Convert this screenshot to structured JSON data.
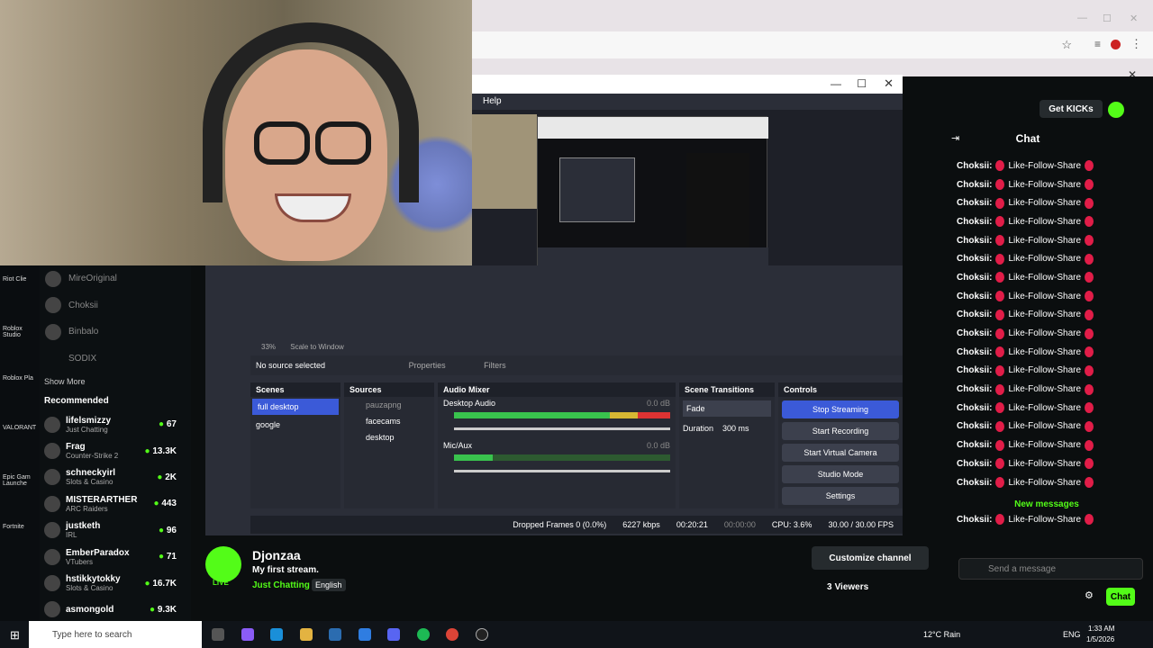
{
  "obs": {
    "menu_help": "Help",
    "zoom": "33%",
    "scale_mode": "Scale to Window",
    "no_source": "No source selected",
    "properties": "Properties",
    "filters": "Filters",
    "scenes_title": "Scenes",
    "scenes": [
      "full desktop",
      "google"
    ],
    "sources_title": "Sources",
    "sources": [
      "pauzapng",
      "facecams",
      "desktop"
    ],
    "mixer_title": "Audio Mixer",
    "desktop_audio": "Desktop Audio",
    "desktop_db": "0.0 dB",
    "mic_aux": "Mic/Aux",
    "mic_db": "0.0 dB",
    "transitions_title": "Scene Transitions",
    "transition": "Fade",
    "duration_label": "Duration",
    "duration": "300 ms",
    "controls_title": "Controls",
    "stop_streaming": "Stop Streaming",
    "start_recording": "Start Recording",
    "start_virtual_camera": "Start Virtual Camera",
    "studio_mode": "Studio Mode",
    "settings": "Settings",
    "dropped_frames": "Dropped Frames 0 (0.0%)",
    "bitrate": "6227 kbps",
    "live_time": "00:20:21",
    "rec_time": "00:00:00",
    "cpu": "CPU: 3.6%",
    "fps": "30.00 / 30.00 FPS"
  },
  "left_sidebar": {
    "followed": [
      "MireOriginal",
      "Choksii",
      "Binbalo",
      "SODIX"
    ],
    "show_more": "Show More",
    "recommended_title": "Recommended",
    "recommended": [
      {
        "name": "lifelsmizzy",
        "category": "Just Chatting",
        "viewers": "67"
      },
      {
        "name": "Frag",
        "category": "Counter-Strike 2",
        "viewers": "13.3K"
      },
      {
        "name": "schneckyirl",
        "category": "Slots & Casino",
        "viewers": "2K"
      },
      {
        "name": "MISTERARTHER",
        "category": "ARC Raiders",
        "viewers": "443"
      },
      {
        "name": "justketh",
        "category": "IRL",
        "viewers": "96"
      },
      {
        "name": "EmberParadox",
        "category": "VTubers",
        "viewers": "71"
      },
      {
        "name": "hstikkytokky",
        "category": "Slots & Casino",
        "viewers": "16.7K"
      },
      {
        "name": "asmongold",
        "category": "",
        "viewers": "9.3K"
      }
    ]
  },
  "desktop_icons": [
    "Riot Clie",
    "Roblox Studio",
    "Roblox Pla",
    "VALORANT",
    "Epic Gam Launche",
    "Fortnite"
  ],
  "stream": {
    "streamer": "Djonzaa",
    "title": "My first stream.",
    "category": "Just Chatting",
    "language": "English",
    "live_badge": "LIVE",
    "customize": "Customize channel",
    "viewers": "3",
    "viewers_label": "Viewers"
  },
  "chat": {
    "header": "Chat",
    "get_kicks": "Get KICKs",
    "user": "Choksii:",
    "message": "Like-Follow-Share",
    "new_messages": "New messages",
    "placeholder": "Send a message",
    "chat_button": "Chat",
    "line_count": 18
  },
  "taskbar": {
    "search_placeholder": "Type here to search",
    "weather": "12°C Rain",
    "lang": "ENG",
    "time": "1:33 AM",
    "date": "1/5/2026"
  },
  "colors": {
    "kick_green": "#53fc18",
    "obs_blue": "#3b5ad8",
    "obs_bg": "#2b2e38"
  }
}
